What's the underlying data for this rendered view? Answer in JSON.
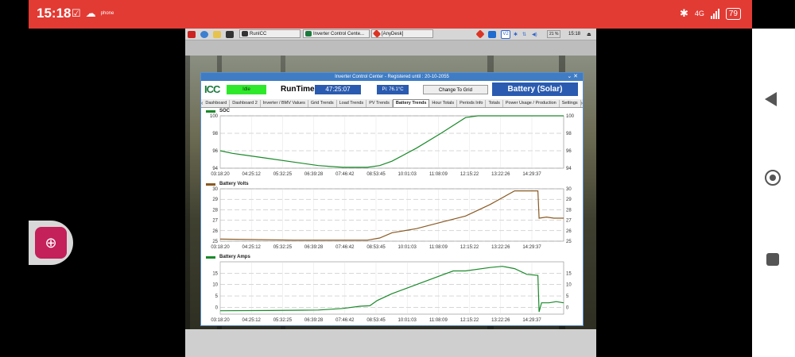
{
  "android": {
    "time": "15:18",
    "network": "4G",
    "battery": "79",
    "notif_small": "phone"
  },
  "pi_taskbar": {
    "tasks": [
      "RunICC",
      "Inverter Control Cente...",
      "[AnyDesk]"
    ],
    "volume_pct": "21 %",
    "clock": "15:18"
  },
  "icc": {
    "title": "Inverter Control Center - Registered until : 20-10-2055",
    "logo": "ICC",
    "status": "Idle",
    "runtime_label": "RunTime",
    "runtime_value": "47:25:07",
    "pi_temp": "Pi: 76.1°C",
    "change_grid": "Change To Grid",
    "mode": "Battery (Solar)",
    "tabs": [
      "Dashboard",
      "Dashboard 2",
      "Inverter / BMV Values",
      "Grid Trends",
      "Load Trends",
      "PV Trends",
      "Battery Trends",
      "Hour Totals",
      "Periods Info",
      "Totals",
      "Power Usage / Production",
      "Settings"
    ],
    "active_tab": "Battery Trends"
  },
  "chart_data": [
    {
      "type": "line",
      "title": "SOC",
      "color": "#1a8a2a",
      "ylim": [
        94,
        100
      ],
      "yticks": [
        94,
        96,
        98,
        100
      ],
      "x_ticks": [
        "03:18:20",
        "04:25:12",
        "05:32:25",
        "06:39:28",
        "07:46:42",
        "08:53:45",
        "10:01:03",
        "11:08:09",
        "12:15:22",
        "13:22:26",
        "14:29:37"
      ],
      "points": [
        [
          0,
          96
        ],
        [
          0.5,
          95.7
        ],
        [
          1,
          95.5
        ],
        [
          2,
          95.1
        ],
        [
          3,
          94.7
        ],
        [
          4,
          94.3
        ],
        [
          5,
          94.1
        ],
        [
          6,
          94.1
        ],
        [
          6.5,
          94.3
        ],
        [
          7,
          94.8
        ],
        [
          8,
          96.3
        ],
        [
          9,
          98
        ],
        [
          10,
          99.8
        ],
        [
          10.5,
          100
        ],
        [
          11,
          100
        ],
        [
          13,
          100
        ],
        [
          14,
          100
        ]
      ]
    },
    {
      "type": "line",
      "title": "Battery Volts",
      "color": "#8a5a23",
      "ylim": [
        25,
        30
      ],
      "yticks": [
        25,
        26,
        27,
        28,
        29,
        30
      ],
      "x_ticks": [
        "03:18:20",
        "04:25:12",
        "05:32:25",
        "06:39:28",
        "07:46:42",
        "08:53:45",
        "10:01:03",
        "11:08:09",
        "12:15:22",
        "13:22:26",
        "14:29:37"
      ],
      "points": [
        [
          0,
          25.2
        ],
        [
          3,
          25.1
        ],
        [
          6,
          25.1
        ],
        [
          6.5,
          25.3
        ],
        [
          7,
          25.8
        ],
        [
          8,
          26.2
        ],
        [
          9,
          26.8
        ],
        [
          10,
          27.4
        ],
        [
          11,
          28.5
        ],
        [
          12,
          29.8
        ],
        [
          12.95,
          29.8
        ],
        [
          13,
          27.2
        ],
        [
          13.3,
          27.3
        ],
        [
          13.6,
          27.2
        ],
        [
          14,
          27.2
        ]
      ]
    },
    {
      "type": "line",
      "title": "Battery Amps",
      "color": "#1a8a2a",
      "ylim": [
        -3,
        20
      ],
      "yticks": [
        0,
        5,
        10,
        15
      ],
      "x_ticks": [
        "03:18:20",
        "04:25:12",
        "05:32:25",
        "06:39:28",
        "07:46:42",
        "08:53:45",
        "10:01:03",
        "11:08:09",
        "12:15:22",
        "13:22:26",
        "14:29:37"
      ],
      "points": [
        [
          0,
          -1.5
        ],
        [
          2,
          -1.4
        ],
        [
          4,
          -1.2
        ],
        [
          5,
          -0.5
        ],
        [
          5.7,
          0.5
        ],
        [
          6.1,
          0.7
        ],
        [
          6.4,
          3
        ],
        [
          7,
          6
        ],
        [
          8,
          10
        ],
        [
          9,
          14
        ],
        [
          9.5,
          16
        ],
        [
          10,
          16
        ],
        [
          11,
          17.5
        ],
        [
          11.5,
          18
        ],
        [
          12,
          17
        ],
        [
          12.5,
          14.5
        ],
        [
          12.95,
          14
        ],
        [
          13,
          -2
        ],
        [
          13.1,
          2
        ],
        [
          13.4,
          2
        ],
        [
          13.7,
          2.5
        ],
        [
          14,
          2
        ]
      ]
    }
  ]
}
